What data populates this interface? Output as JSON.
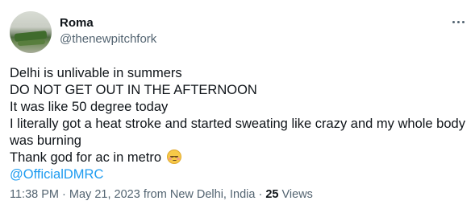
{
  "author": {
    "display_name": "Roma",
    "handle": "@thenewpitchfork",
    "avatar_icon": "profile-photo"
  },
  "tweet": {
    "lines": [
      "Delhi is unlivable in summers",
      "DO NOT GET OUT IN THE AFTERNOON",
      "It was like 50 degree today",
      "I literally got a heat stroke and started sweating like crazy and my whole body was burning",
      "Thank god for ac in metro"
    ],
    "emoji_icon": "smiling-face-with-blush-icon",
    "mention": "@OfficialDMRC"
  },
  "meta": {
    "time": "11:38 PM",
    "date": "May 21, 2023",
    "location_prefix": "from",
    "location": "New Delhi, India",
    "separator": "·",
    "views_count": "25",
    "views_label": "Views"
  },
  "colors": {
    "text": "#0f1419",
    "secondary": "#536471",
    "link": "#1d9bf0"
  }
}
